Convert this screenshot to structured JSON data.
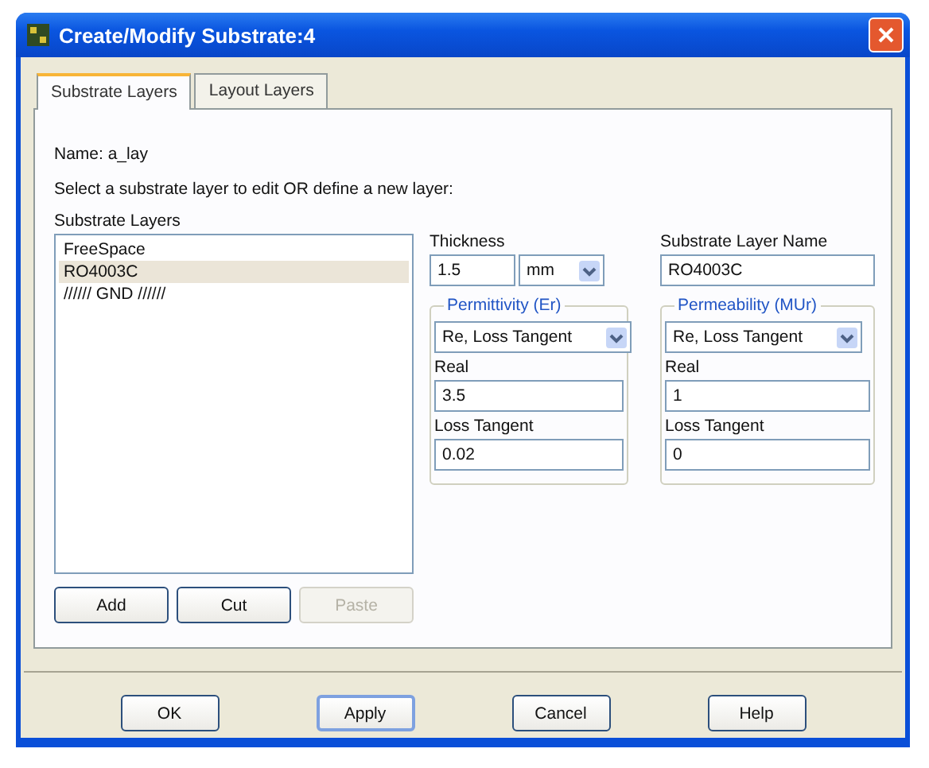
{
  "window": {
    "title": "Create/Modify Substrate:4"
  },
  "tabs": [
    {
      "label": "Substrate Layers",
      "selected": true
    },
    {
      "label": "Layout Layers",
      "selected": false
    }
  ],
  "name_label": "Name: a_lay",
  "instruction": "Select a substrate layer to edit OR define a new layer:",
  "layers": {
    "label": "Substrate Layers",
    "items": [
      {
        "label": "FreeSpace",
        "selected": false
      },
      {
        "label": "RO4003C",
        "selected": true
      },
      {
        "label": "////// GND //////",
        "selected": false
      }
    ]
  },
  "list_buttons": [
    {
      "label": "Add",
      "disabled": false
    },
    {
      "label": "Cut",
      "disabled": false
    },
    {
      "label": "Paste",
      "disabled": true
    }
  ],
  "thickness": {
    "label": "Thickness",
    "value": "1.5",
    "unit": "mm"
  },
  "layer_name": {
    "label": "Substrate Layer Name",
    "value": "RO4003C"
  },
  "groups": [
    {
      "title": "Permittivity (Er)",
      "model": "Re, Loss Tangent",
      "real_label": "Real",
      "real": "3.5",
      "loss_label": "Loss Tangent",
      "loss": "0.02"
    },
    {
      "title": "Permeability (MUr)",
      "model": "Re, Loss Tangent",
      "real_label": "Real",
      "real": "1",
      "loss_label": "Loss Tangent",
      "loss": "0"
    }
  ],
  "footer_buttons": [
    {
      "label": "OK",
      "default": false
    },
    {
      "label": "Apply",
      "default": true
    },
    {
      "label": "Cancel",
      "default": false
    },
    {
      "label": "Help",
      "default": false
    }
  ]
}
